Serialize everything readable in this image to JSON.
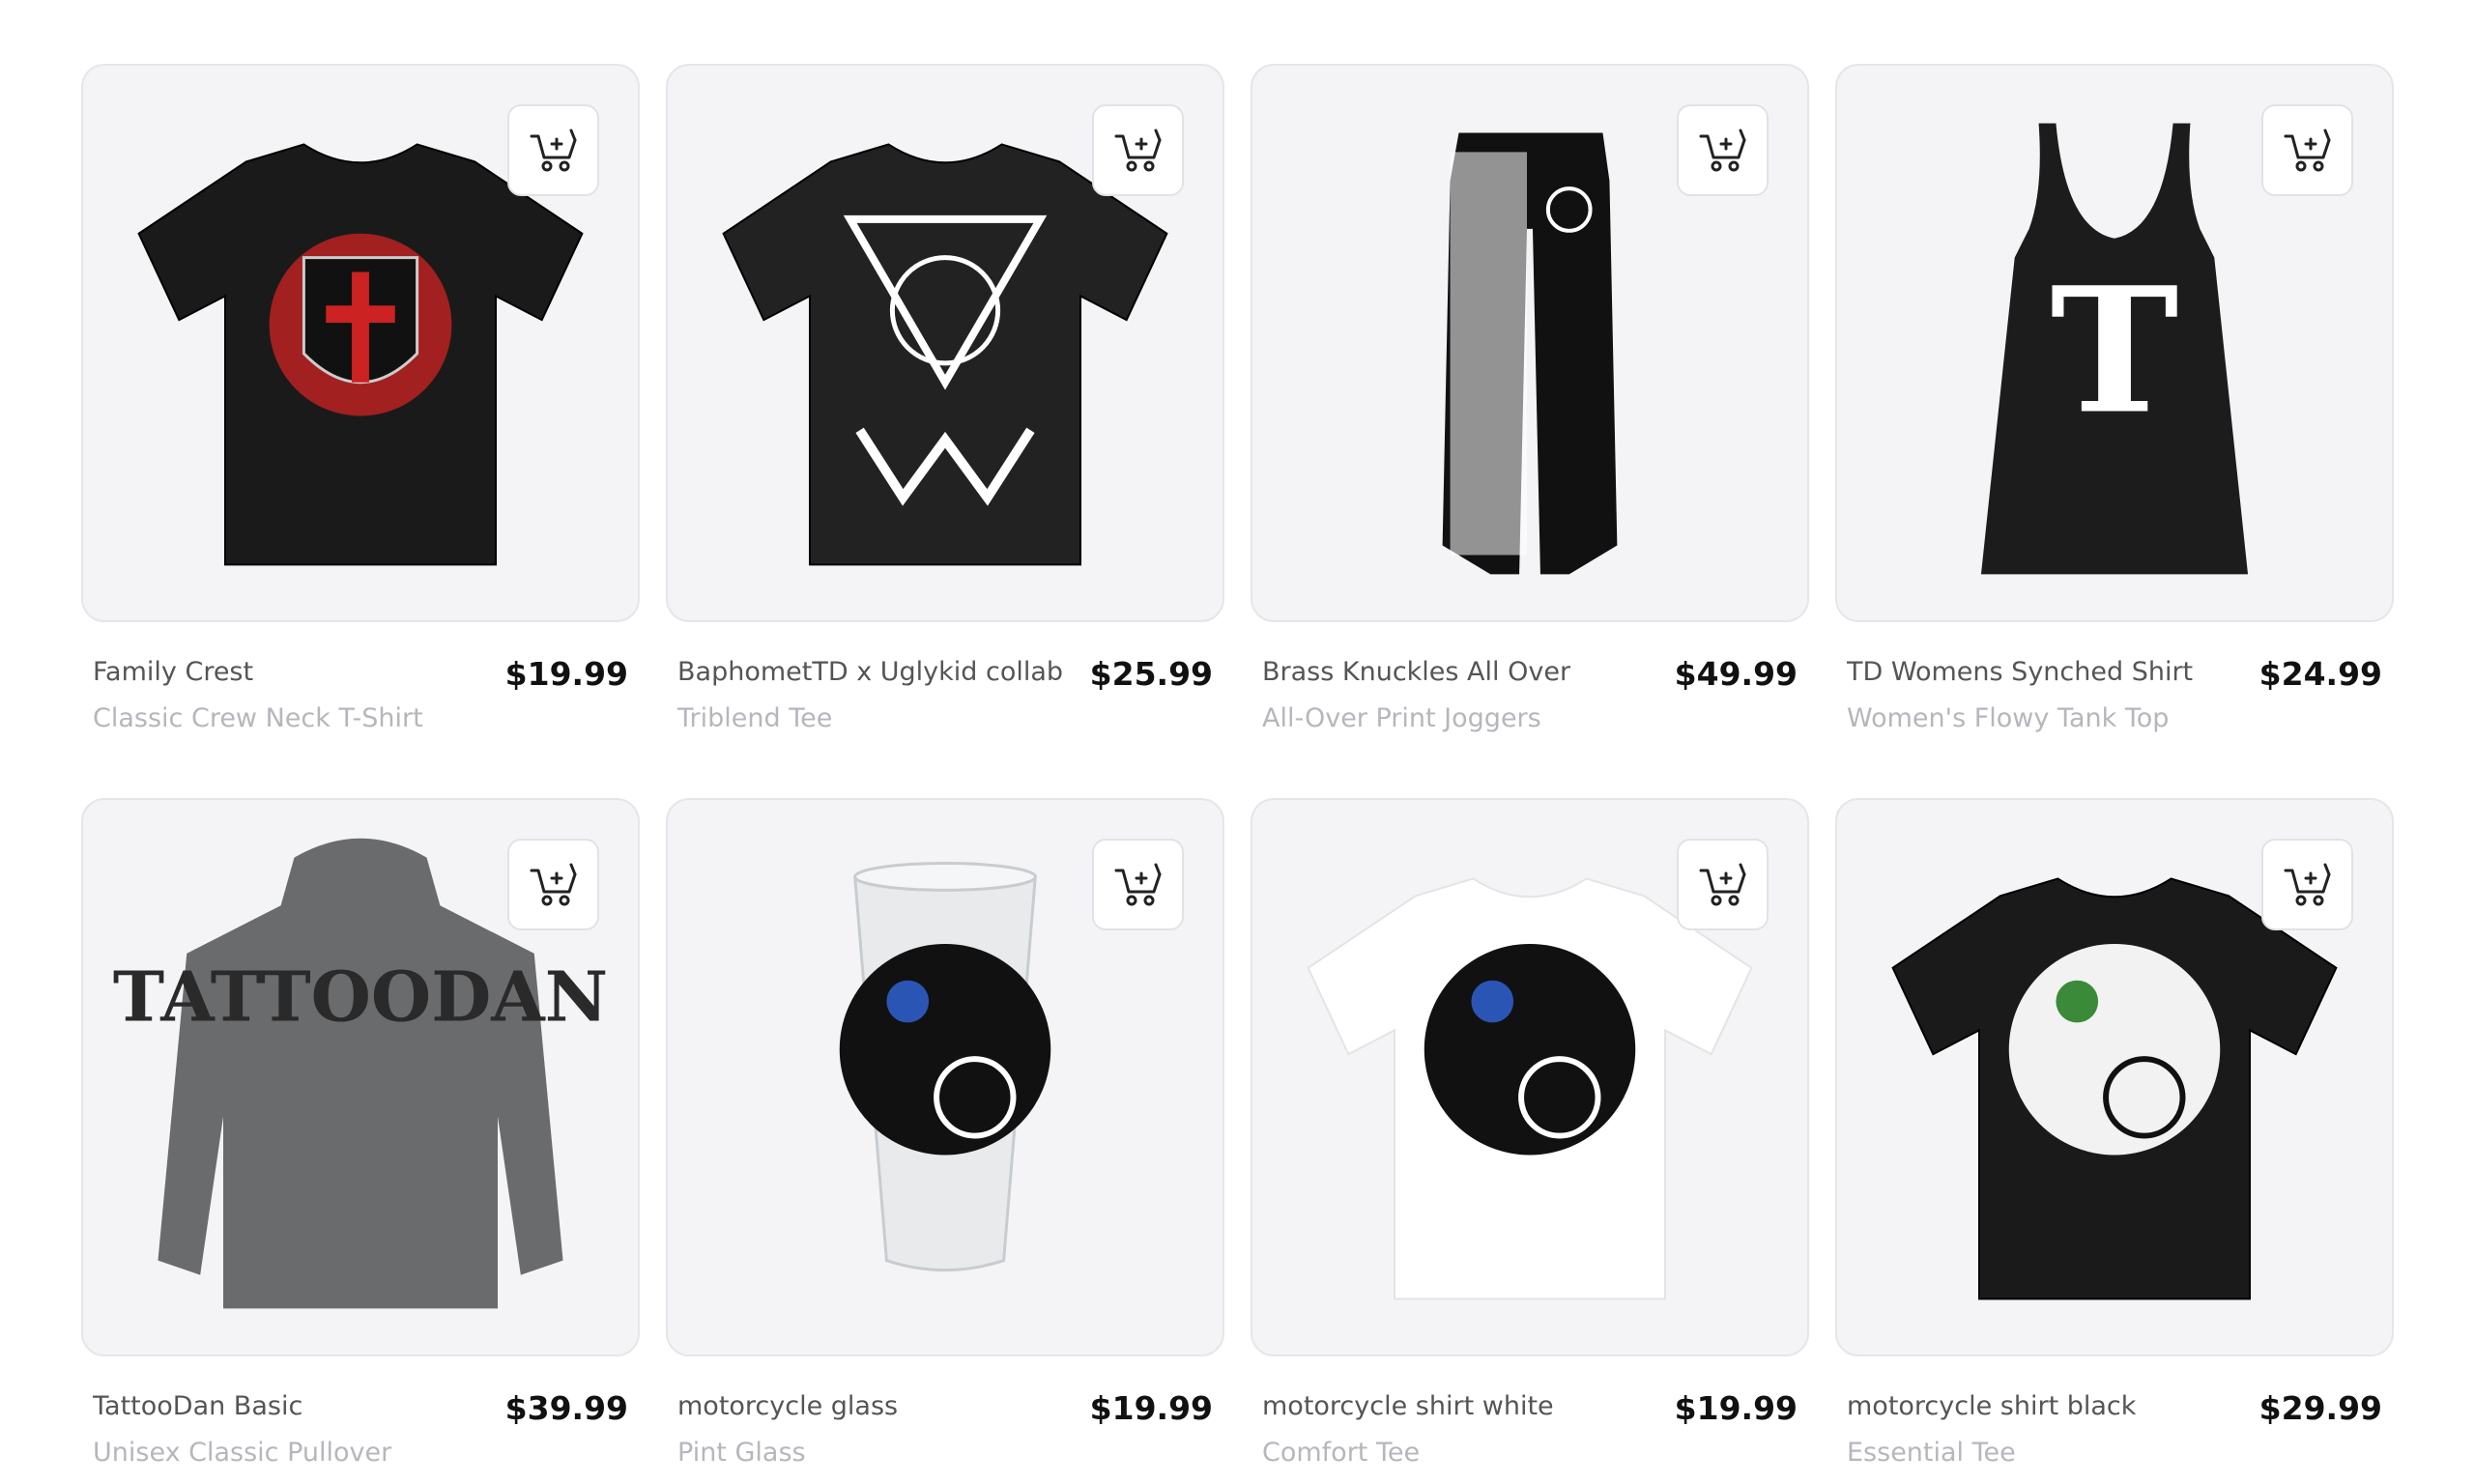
{
  "products": [
    {
      "name": "Family Crest",
      "price": "$19.99",
      "type": "Classic Crew Neck T-Shirt",
      "garment": "tshirt",
      "color": "#1a1a1a",
      "print": "crest",
      "icon": "cart-add-icon"
    },
    {
      "name": "BaphometTD x Uglykid collab",
      "price": "$25.99",
      "type": "Triblend Tee",
      "garment": "tshirt",
      "color": "#222222",
      "print": "baphomet",
      "icon": "cart-add-icon"
    },
    {
      "name": "Brass Knuckles All Over",
      "price": "$49.99",
      "type": "All-Over Print Joggers",
      "garment": "joggers",
      "color": "#111111",
      "print": "splatter",
      "icon": "cart-add-icon"
    },
    {
      "name": "TD Womens Synched Shirt",
      "price": "$24.99",
      "type": "Women's Flowy Tank Top",
      "garment": "tank",
      "color": "#1c1c1c",
      "print": "monogram",
      "icon": "cart-add-icon"
    },
    {
      "name": "TattooDan Basic",
      "price": "$39.99",
      "type": "Unisex Classic Pullover",
      "garment": "hoodie",
      "color": "#6a6b6d",
      "print": "tattoodan-logo",
      "icon": "cart-add-icon"
    },
    {
      "name": "motorcycle glass",
      "price": "$19.99",
      "type": "Pint Glass",
      "garment": "glass",
      "color": "#e8eaec",
      "print": "around-the-world",
      "icon": "cart-add-icon"
    },
    {
      "name": "motorcycle shirt white",
      "price": "$19.99",
      "type": "Comfort Tee",
      "garment": "tshirt",
      "color": "#ffffff",
      "print": "around-the-world",
      "icon": "cart-add-icon"
    },
    {
      "name": "motorcycle shirt black",
      "price": "$29.99",
      "type": "Essential Tee",
      "garment": "tshirt",
      "color": "#1a1a1a",
      "print": "around-the-world-white",
      "icon": "cart-add-icon"
    }
  ]
}
